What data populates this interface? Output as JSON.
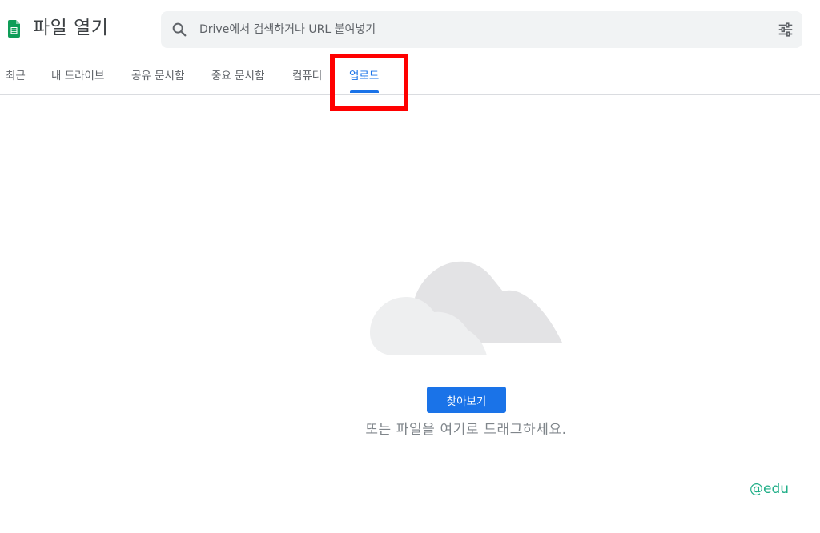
{
  "header": {
    "title": "파일 열기",
    "app_icon": "sheets-icon",
    "app_icon_color": "#0f9d58"
  },
  "search": {
    "placeholder": "Drive에서 검색하거나 URL 붙여넣기",
    "value": "",
    "search_icon": "search-icon",
    "options_icon": "tune-icon"
  },
  "tabs": [
    {
      "label": "최근",
      "active": false
    },
    {
      "label": "내 드라이브",
      "active": false
    },
    {
      "label": "공유 문서함",
      "active": false
    },
    {
      "label": "중요 문서함",
      "active": false
    },
    {
      "label": "컴퓨터",
      "active": false
    },
    {
      "label": "업로드",
      "active": true
    }
  ],
  "upload": {
    "browse_label": "찾아보기",
    "drag_hint": "또는 파일을 여기로 드래그하세요.",
    "illustration": "cloud-icon"
  },
  "watermark": "@edu",
  "colors": {
    "accent": "#1a73e8",
    "highlight": "#ff0000",
    "watermark": "#1fae87"
  }
}
